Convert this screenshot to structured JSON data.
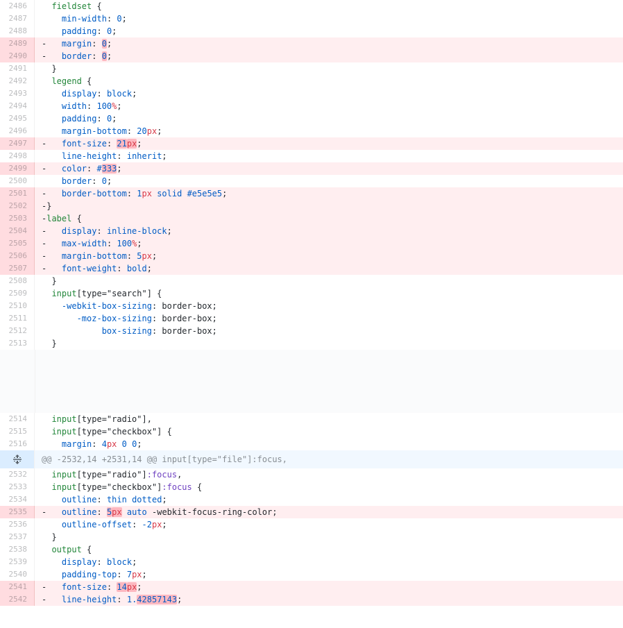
{
  "diff": {
    "rows": [
      {
        "ln": "2486",
        "t": "ctx",
        "c": [
          [
            "  ",
            ""
          ],
          [
            "fieldset",
            "sel"
          ],
          [
            " {",
            ""
          ]
        ]
      },
      {
        "ln": "2487",
        "t": "ctx",
        "c": [
          [
            "    ",
            ""
          ],
          [
            "min-width",
            "prop"
          ],
          [
            ": ",
            ""
          ],
          [
            "0",
            "num"
          ],
          [
            ";",
            ""
          ]
        ]
      },
      {
        "ln": "2488",
        "t": "ctx",
        "c": [
          [
            "    ",
            ""
          ],
          [
            "padding",
            "prop"
          ],
          [
            ": ",
            ""
          ],
          [
            "0",
            "num"
          ],
          [
            ";",
            ""
          ]
        ]
      },
      {
        "ln": "2489",
        "t": "del",
        "c": [
          [
            "- ",
            ""
          ],
          [
            "  ",
            ""
          ],
          [
            "margin",
            "prop"
          ],
          [
            ": ",
            ""
          ],
          [
            "0",
            "num hl"
          ],
          [
            ";",
            ""
          ]
        ]
      },
      {
        "ln": "2490",
        "t": "del",
        "c": [
          [
            "- ",
            ""
          ],
          [
            "  ",
            ""
          ],
          [
            "border",
            "prop"
          ],
          [
            ": ",
            ""
          ],
          [
            "0",
            "num hl"
          ],
          [
            ";",
            ""
          ]
        ]
      },
      {
        "ln": "2491",
        "t": "ctx",
        "c": [
          [
            "  }",
            ""
          ]
        ]
      },
      {
        "ln": "2492",
        "t": "ctx",
        "c": [
          [
            "  ",
            ""
          ],
          [
            "legend",
            "sel"
          ],
          [
            " {",
            ""
          ]
        ]
      },
      {
        "ln": "2493",
        "t": "ctx",
        "c": [
          [
            "    ",
            ""
          ],
          [
            "display",
            "prop"
          ],
          [
            ": ",
            ""
          ],
          [
            "block",
            "num"
          ],
          [
            ";",
            ""
          ]
        ]
      },
      {
        "ln": "2494",
        "t": "ctx",
        "c": [
          [
            "    ",
            ""
          ],
          [
            "width",
            "prop"
          ],
          [
            ": ",
            ""
          ],
          [
            "100",
            "num"
          ],
          [
            "%",
            "unit"
          ],
          [
            ";",
            ""
          ]
        ]
      },
      {
        "ln": "2495",
        "t": "ctx",
        "c": [
          [
            "    ",
            ""
          ],
          [
            "padding",
            "prop"
          ],
          [
            ": ",
            ""
          ],
          [
            "0",
            "num"
          ],
          [
            ";",
            ""
          ]
        ]
      },
      {
        "ln": "2496",
        "t": "ctx",
        "c": [
          [
            "    ",
            ""
          ],
          [
            "margin-bottom",
            "prop"
          ],
          [
            ": ",
            ""
          ],
          [
            "20",
            "num"
          ],
          [
            "px",
            "unit"
          ],
          [
            ";",
            ""
          ]
        ]
      },
      {
        "ln": "2497",
        "t": "del",
        "c": [
          [
            "- ",
            ""
          ],
          [
            "  ",
            ""
          ],
          [
            "font-size",
            "prop"
          ],
          [
            ": ",
            ""
          ],
          [
            "21",
            "num hl"
          ],
          [
            "px",
            "unit hl"
          ],
          [
            ";",
            ""
          ]
        ]
      },
      {
        "ln": "2498",
        "t": "ctx",
        "c": [
          [
            "    ",
            ""
          ],
          [
            "line-height",
            "prop"
          ],
          [
            ": ",
            ""
          ],
          [
            "inherit",
            "num"
          ],
          [
            ";",
            ""
          ]
        ]
      },
      {
        "ln": "2499",
        "t": "del",
        "c": [
          [
            "- ",
            ""
          ],
          [
            "  ",
            ""
          ],
          [
            "color",
            "prop"
          ],
          [
            ": ",
            ""
          ],
          [
            "#",
            "num"
          ],
          [
            "333",
            "num hl"
          ],
          [
            ";",
            ""
          ]
        ]
      },
      {
        "ln": "2500",
        "t": "ctx",
        "c": [
          [
            "    ",
            ""
          ],
          [
            "border",
            "prop"
          ],
          [
            ": ",
            ""
          ],
          [
            "0",
            "num"
          ],
          [
            ";",
            ""
          ]
        ]
      },
      {
        "ln": "2501",
        "t": "del",
        "c": [
          [
            "- ",
            ""
          ],
          [
            "  ",
            ""
          ],
          [
            "border-bottom",
            "prop"
          ],
          [
            ": ",
            ""
          ],
          [
            "1",
            "num"
          ],
          [
            "px",
            "unit"
          ],
          [
            " ",
            ""
          ],
          [
            "solid",
            "num"
          ],
          [
            " ",
            ""
          ],
          [
            "#e5e5e5",
            "num"
          ],
          [
            ";",
            ""
          ]
        ]
      },
      {
        "ln": "2502",
        "t": "del",
        "c": [
          [
            "-}",
            ""
          ]
        ]
      },
      {
        "ln": "2503",
        "t": "del",
        "c": [
          [
            "-",
            ""
          ],
          [
            "label",
            "sel"
          ],
          [
            " {",
            ""
          ]
        ]
      },
      {
        "ln": "2504",
        "t": "del",
        "c": [
          [
            "- ",
            ""
          ],
          [
            "  ",
            ""
          ],
          [
            "display",
            "prop"
          ],
          [
            ": ",
            ""
          ],
          [
            "inline-block",
            "num"
          ],
          [
            ";",
            ""
          ]
        ]
      },
      {
        "ln": "2505",
        "t": "del",
        "c": [
          [
            "- ",
            ""
          ],
          [
            "  ",
            ""
          ],
          [
            "max-width",
            "prop"
          ],
          [
            ": ",
            ""
          ],
          [
            "100",
            "num"
          ],
          [
            "%",
            "unit"
          ],
          [
            ";",
            ""
          ]
        ]
      },
      {
        "ln": "2506",
        "t": "del",
        "c": [
          [
            "- ",
            ""
          ],
          [
            "  ",
            ""
          ],
          [
            "margin-bottom",
            "prop"
          ],
          [
            ": ",
            ""
          ],
          [
            "5",
            "num"
          ],
          [
            "px",
            "unit"
          ],
          [
            ";",
            ""
          ]
        ]
      },
      {
        "ln": "2507",
        "t": "del",
        "c": [
          [
            "- ",
            ""
          ],
          [
            "  ",
            ""
          ],
          [
            "font-weight",
            "prop"
          ],
          [
            ": ",
            ""
          ],
          [
            "bold",
            "num"
          ],
          [
            ";",
            ""
          ]
        ]
      },
      {
        "ln": "2508",
        "t": "ctx",
        "c": [
          [
            "  }",
            ""
          ]
        ]
      },
      {
        "ln": "2509",
        "t": "ctx",
        "c": [
          [
            "  ",
            ""
          ],
          [
            "input",
            "sel"
          ],
          [
            "[type=\"search\"] {",
            ""
          ]
        ]
      },
      {
        "ln": "2510",
        "t": "ctx",
        "c": [
          [
            "    ",
            ""
          ],
          [
            "-webkit-box-sizing",
            "prop"
          ],
          [
            ": border-box;",
            ""
          ]
        ]
      },
      {
        "ln": "2511",
        "t": "ctx",
        "c": [
          [
            "       ",
            ""
          ],
          [
            "-moz-box-sizing",
            "prop"
          ],
          [
            ": border-box;",
            ""
          ]
        ]
      },
      {
        "ln": "2512",
        "t": "ctx",
        "c": [
          [
            "            ",
            ""
          ],
          [
            "box-sizing",
            "prop"
          ],
          [
            ": border-box;",
            ""
          ]
        ]
      },
      {
        "ln": "2513",
        "t": "ctx",
        "c": [
          [
            "  }",
            ""
          ]
        ]
      },
      {
        "t": "gap"
      },
      {
        "ln": "2514",
        "t": "ctx",
        "c": [
          [
            "  ",
            ""
          ],
          [
            "input",
            "sel"
          ],
          [
            "[type=\"radio\"],",
            ""
          ]
        ]
      },
      {
        "ln": "2515",
        "t": "ctx",
        "c": [
          [
            "  ",
            ""
          ],
          [
            "input",
            "sel"
          ],
          [
            "[type=\"checkbox\"] {",
            ""
          ]
        ]
      },
      {
        "ln": "2516",
        "t": "ctx",
        "c": [
          [
            "    ",
            ""
          ],
          [
            "margin",
            "prop"
          ],
          [
            ": ",
            ""
          ],
          [
            "4",
            "num"
          ],
          [
            "px",
            "unit"
          ],
          [
            " ",
            ""
          ],
          [
            "0",
            "num"
          ],
          [
            " ",
            ""
          ],
          [
            "0",
            "num"
          ],
          [
            ";",
            ""
          ]
        ]
      },
      {
        "t": "hunk",
        "text": "@@ -2532,14 +2531,14 @@ input[type=\"file\"]:focus,"
      },
      {
        "ln": "2532",
        "t": "ctx",
        "c": [
          [
            "  ",
            ""
          ],
          [
            "input",
            "sel"
          ],
          [
            "[type=\"radio\"]",
            ""
          ],
          [
            ":focus",
            "pseudo"
          ],
          [
            ",",
            ""
          ]
        ]
      },
      {
        "ln": "2533",
        "t": "ctx",
        "c": [
          [
            "  ",
            ""
          ],
          [
            "input",
            "sel"
          ],
          [
            "[type=\"checkbox\"]",
            ""
          ],
          [
            ":focus",
            "pseudo"
          ],
          [
            " {",
            ""
          ]
        ]
      },
      {
        "ln": "2534",
        "t": "ctx",
        "c": [
          [
            "    ",
            ""
          ],
          [
            "outline",
            "prop"
          ],
          [
            ": ",
            ""
          ],
          [
            "thin",
            "num"
          ],
          [
            " ",
            ""
          ],
          [
            "dotted",
            "num"
          ],
          [
            ";",
            ""
          ]
        ]
      },
      {
        "ln": "2535",
        "t": "del",
        "c": [
          [
            "- ",
            ""
          ],
          [
            "  ",
            ""
          ],
          [
            "outline",
            "prop"
          ],
          [
            ": ",
            ""
          ],
          [
            "5",
            "num hl"
          ],
          [
            "px",
            "unit hl"
          ],
          [
            " ",
            ""
          ],
          [
            "auto",
            "num"
          ],
          [
            " -webkit-focus-ring-color;",
            ""
          ]
        ]
      },
      {
        "ln": "2536",
        "t": "ctx",
        "c": [
          [
            "    ",
            ""
          ],
          [
            "outline-offset",
            "prop"
          ],
          [
            ": ",
            ""
          ],
          [
            "-2",
            "num"
          ],
          [
            "px",
            "unit"
          ],
          [
            ";",
            ""
          ]
        ]
      },
      {
        "ln": "2537",
        "t": "ctx",
        "c": [
          [
            "  }",
            ""
          ]
        ]
      },
      {
        "ln": "2538",
        "t": "ctx",
        "c": [
          [
            "  ",
            ""
          ],
          [
            "output",
            "sel"
          ],
          [
            " {",
            ""
          ]
        ]
      },
      {
        "ln": "2539",
        "t": "ctx",
        "c": [
          [
            "    ",
            ""
          ],
          [
            "display",
            "prop"
          ],
          [
            ": ",
            ""
          ],
          [
            "block",
            "num"
          ],
          [
            ";",
            ""
          ]
        ]
      },
      {
        "ln": "2540",
        "t": "ctx",
        "c": [
          [
            "    ",
            ""
          ],
          [
            "padding-top",
            "prop"
          ],
          [
            ": ",
            ""
          ],
          [
            "7",
            "num"
          ],
          [
            "px",
            "unit"
          ],
          [
            ";",
            ""
          ]
        ]
      },
      {
        "ln": "2541",
        "t": "del",
        "c": [
          [
            "- ",
            ""
          ],
          [
            "  ",
            ""
          ],
          [
            "font-size",
            "prop"
          ],
          [
            ": ",
            ""
          ],
          [
            "14",
            "num hl"
          ],
          [
            "px",
            "unit hl"
          ],
          [
            ";",
            ""
          ]
        ]
      },
      {
        "ln": "2542",
        "t": "del",
        "c": [
          [
            "- ",
            ""
          ],
          [
            "  ",
            ""
          ],
          [
            "line-height",
            "prop"
          ],
          [
            ": ",
            ""
          ],
          [
            "1.",
            "num"
          ],
          [
            "42857143",
            "num hl"
          ],
          [
            ";",
            ""
          ]
        ]
      }
    ]
  },
  "icons": {
    "expand": "unfold-icon"
  },
  "colors": {
    "deletion_bg": "#ffeef0",
    "deletion_gutter": "#ffdce0",
    "hunk_bg": "#f1f8ff"
  }
}
